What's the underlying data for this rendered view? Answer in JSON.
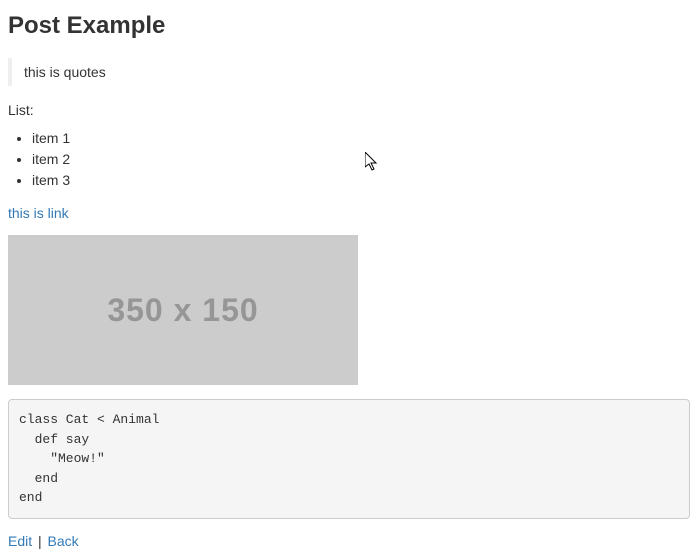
{
  "post": {
    "title": "Post Example",
    "quote": "this is quotes",
    "list_label": "List:",
    "items": [
      "item 1",
      "item 2",
      "item 3"
    ],
    "link_text": "this is link",
    "placeholder_label": "350 x 150",
    "code": "class Cat < Animal\n  def say\n    \"Meow!\"\n  end\nend",
    "actions": {
      "edit": "Edit",
      "separator": "|",
      "back": "Back"
    }
  }
}
